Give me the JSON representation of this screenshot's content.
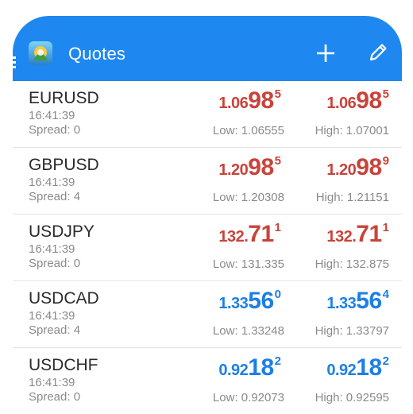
{
  "appbar": {
    "title": "Quotes",
    "color": "#1e88f0",
    "icons": [
      "menu-icon",
      "app-logo-icon",
      "add-icon",
      "edit-icon"
    ]
  },
  "colors": {
    "down": "#c9433b",
    "up": "#1c7fe6",
    "muted": "#8a8a8a"
  },
  "quotes": [
    {
      "symbol": "EURUSD",
      "time": "16:41:39",
      "spread": "Spread: 0",
      "direction": "down",
      "bid": {
        "base": "1.06",
        "big": "98",
        "sup": "5"
      },
      "ask": {
        "base": "1.06",
        "big": "98",
        "sup": "5"
      },
      "low": "Low: 1.06555",
      "high": "High: 1.07001"
    },
    {
      "symbol": "GBPUSD",
      "time": "16:41:39",
      "spread": "Spread: 4",
      "direction": "down",
      "bid": {
        "base": "1.20",
        "big": "98",
        "sup": "5"
      },
      "ask": {
        "base": "1.20",
        "big": "98",
        "sup": "9"
      },
      "low": "Low: 1.20308",
      "high": "High: 1.21151"
    },
    {
      "symbol": "USDJPY",
      "time": "16:41:39",
      "spread": "Spread: 0",
      "direction": "down",
      "bid": {
        "base": "132.",
        "big": "71",
        "sup": "1"
      },
      "ask": {
        "base": "132.",
        "big": "71",
        "sup": "1"
      },
      "low": "Low: 131.335",
      "high": "High: 132.875"
    },
    {
      "symbol": "USDCAD",
      "time": "16:41:39",
      "spread": "Spread: 4",
      "direction": "up",
      "bid": {
        "base": "1.33",
        "big": "56",
        "sup": "0"
      },
      "ask": {
        "base": "1.33",
        "big": "56",
        "sup": "4"
      },
      "low": "Low: 1.33248",
      "high": "High: 1.33797"
    },
    {
      "symbol": "USDCHF",
      "time": "16:41:39",
      "spread": "Spread: 0",
      "direction": "up",
      "bid": {
        "base": "0.92",
        "big": "18",
        "sup": "2"
      },
      "ask": {
        "base": "0.92",
        "big": "18",
        "sup": "2"
      },
      "low": "Low: 0.92073",
      "high": "High: 0.92595"
    }
  ]
}
